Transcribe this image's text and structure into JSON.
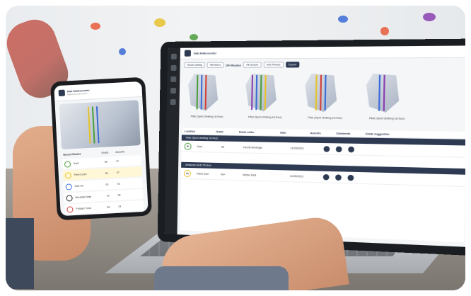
{
  "laptop": {
    "app_name": "Dab Klatrecenter",
    "tabs": [
      "Route setting",
      "Members"
    ],
    "section_title": "DFI Routes",
    "filter_label": "All sectors",
    "add_button": "Add Routes",
    "export_button": "Export",
    "route_cards": [
      "Pillar (Sport climbing 1st floor)",
      "Pillar (Sport climbing 1st floor)",
      "Pillar (Sport climbing 1st floor)",
      "Pillar (Sport climbing 1st floor)"
    ],
    "table": {
      "headers": [
        "Location",
        "Grade",
        "Route setter",
        "Date",
        "Ascents",
        "Comments",
        "Grade suggestion"
      ],
      "group1": "Pillar (Sport climbing 1st floor)",
      "row1": {
        "badge": "6b",
        "name": "Kant",
        "sub": "Pillar",
        "grade": "6b",
        "setter": "Henrik Mortinger",
        "date": "11/09/2023"
      },
      "group2": "Aeldlorad Hertil 7th floor",
      "row2": {
        "badge": "6a",
        "name": "Plane bum",
        "sub": "Pillar",
        "grade": "6a+",
        "setter": "Stefan Fast",
        "date": "11/09/2023"
      }
    }
  },
  "phone": {
    "app_name": "Dab Klatrecenter",
    "subtitle": "Added 10 new routes",
    "section_label": "Recent Routes",
    "columns": [
      "Grade",
      "Ascents"
    ],
    "routes": [
      {
        "name": "Kant",
        "sub": "Pillar",
        "grade": "6b",
        "ascents": "47"
      },
      {
        "name": "Pierre bum",
        "sub": "Pillar",
        "grade": "6a",
        "ascents": "47"
      },
      {
        "name": "Dab nix",
        "sub": "Pillar",
        "grade": "6c",
        "ascents": "43"
      },
      {
        "name": "Mountain Map",
        "sub": "Pillar",
        "grade": "7a",
        "ascents": "36"
      },
      {
        "name": "Friday's Tuna",
        "sub": "Pillar",
        "grade": "6a",
        "ascents": "24"
      }
    ]
  },
  "colors": {
    "navy": "#2d3a52",
    "green": "#4a9d3c",
    "yellow": "#e6c22b",
    "red": "#d2403a",
    "blue": "#3b6bd6",
    "purple": "#8a3fb0"
  }
}
